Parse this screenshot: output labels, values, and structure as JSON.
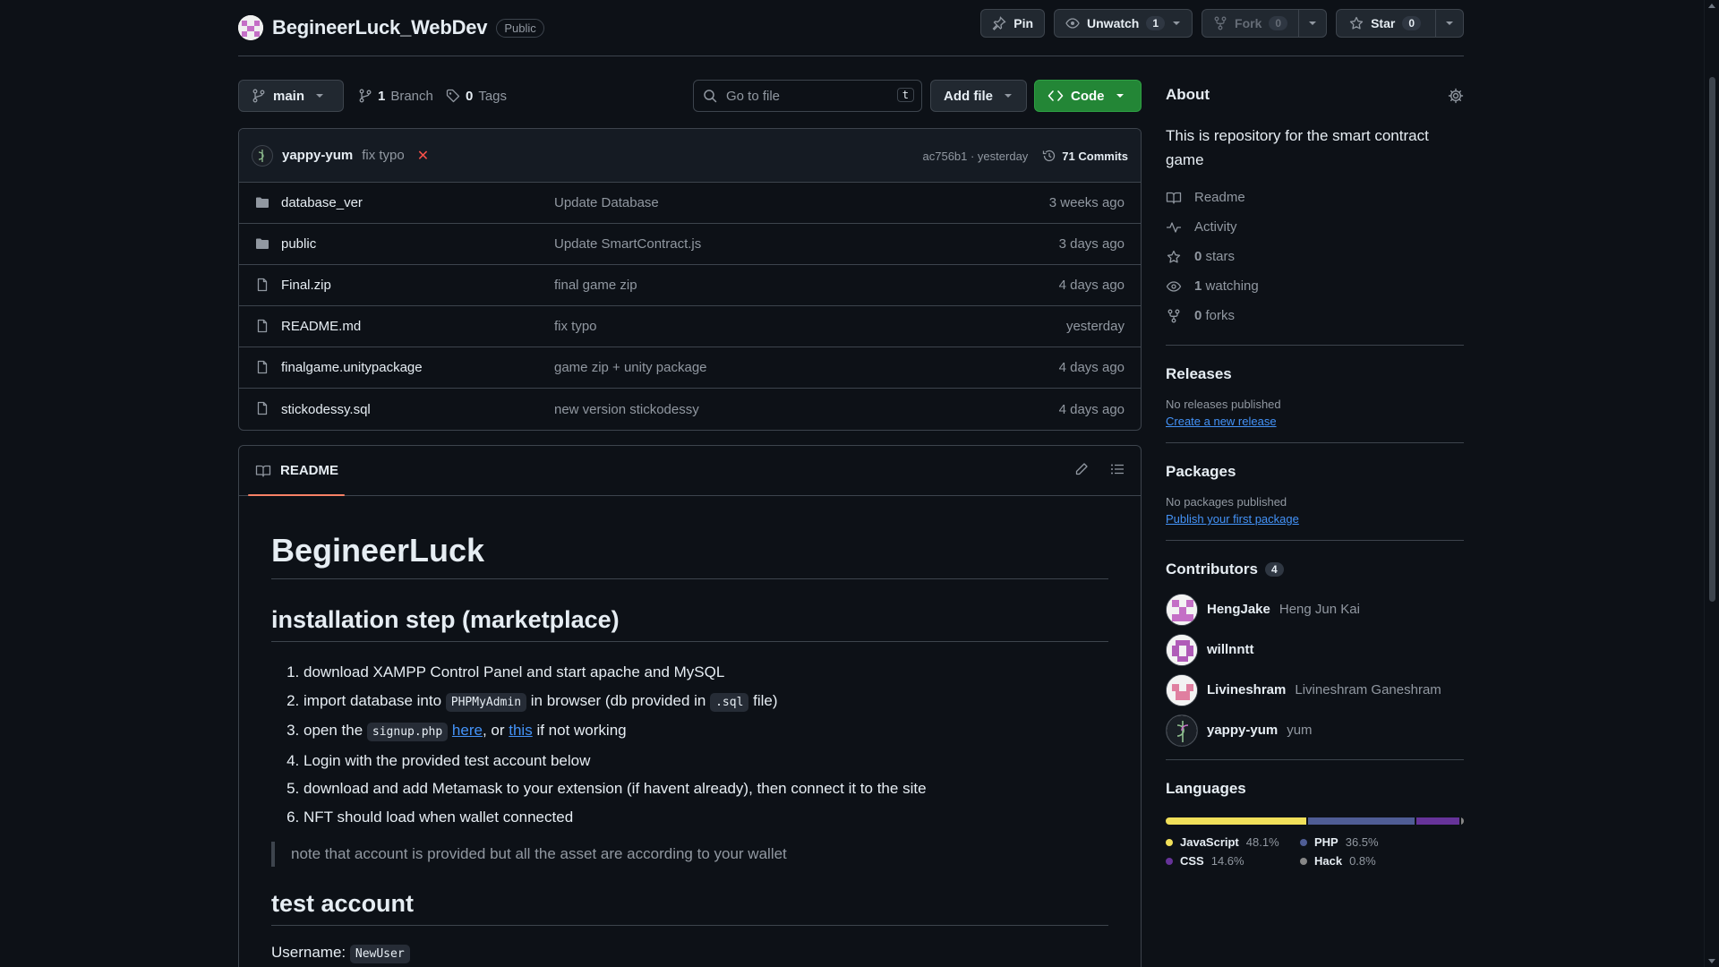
{
  "repo": {
    "name": "BegineerLuck_WebDev",
    "visibility": "Public"
  },
  "actions": {
    "pin": "Pin",
    "unwatch": "Unwatch",
    "watch_count": "1",
    "fork": "Fork",
    "fork_count": "0",
    "star": "Star",
    "star_count": "0"
  },
  "toolbar": {
    "branch": "main",
    "branches_count": "1",
    "branches_label": "Branch",
    "tags_count": "0",
    "tags_label": "Tags",
    "search_placeholder": "Go to file",
    "search_shortcut": "t",
    "add_file": "Add file",
    "code": "Code"
  },
  "latest_commit": {
    "user": "yappy-yum",
    "message": "fix typo",
    "status": "✕",
    "sha_time": "ac756b1 · yesterday",
    "commits": "71 Commits"
  },
  "files": [
    {
      "type": "dir",
      "name": "database_ver",
      "commit": "Update Database",
      "date": "3 weeks ago"
    },
    {
      "type": "dir",
      "name": "public",
      "commit": "Update SmartContract.js",
      "date": "3 days ago"
    },
    {
      "type": "file",
      "name": "Final.zip",
      "commit": "final game zip",
      "date": "4 days ago"
    },
    {
      "type": "file",
      "name": "README.md",
      "commit": "fix typo",
      "date": "yesterday"
    },
    {
      "type": "file",
      "name": "finalgame.unitypackage",
      "commit": "game zip + unity package",
      "date": "4 days ago"
    },
    {
      "type": "file",
      "name": "stickodessy.sql",
      "commit": "new version stickodessy",
      "date": "4 days ago"
    }
  ],
  "readme": {
    "tab": "README",
    "h1": "BegineerLuck",
    "h2_install": "installation step (marketplace)",
    "step1": "download XAMPP Control Panel and start apache and MySQL",
    "step2_a": "import database into ",
    "step2_code1": "PHPMyAdmin",
    "step2_b": " in browser (db provided in ",
    "step2_code2": ".sql",
    "step2_c": " file)",
    "step3_a": "open the ",
    "step3_code": "signup.php",
    "step3_link1": "here",
    "step3_b": ", or ",
    "step3_link2": "this",
    "step3_c": " if not working",
    "step4": "Login with the provided test account below",
    "step5": "download and add Metamask to your extension (if havent already), then connect it to the site",
    "step6": "NFT should load when wallet connected",
    "quote": "note that account is provided but all the asset are according to your wallet",
    "h2_test": "test account",
    "username_label": "Username: ",
    "username_value": "NewUser"
  },
  "about": {
    "title": "About",
    "description": "This is repository for the smart contract game",
    "readme": "Readme",
    "activity": "Activity",
    "stars_count": "0",
    "stars_label": "stars",
    "watching_count": "1",
    "watching_label": "watching",
    "forks_count": "0",
    "forks_label": "forks"
  },
  "releases": {
    "title": "Releases",
    "none": "No releases published",
    "link": "Create a new release"
  },
  "packages": {
    "title": "Packages",
    "none": "No packages published",
    "link": "Publish your first package"
  },
  "contributors": {
    "title": "Contributors",
    "count": "4",
    "list": [
      {
        "login": "HengJake",
        "name": "Heng Jun Kai"
      },
      {
        "login": "willnntt",
        "name": ""
      },
      {
        "login": "Livineshram",
        "name": "Livineshram Ganeshram"
      },
      {
        "login": "yappy-yum",
        "name": "yum"
      }
    ]
  },
  "languages": {
    "title": "Languages",
    "list": [
      {
        "name": "JavaScript",
        "pct": "48.1%",
        "value": 48.1,
        "color": "#f1e05a"
      },
      {
        "name": "PHP",
        "pct": "36.5%",
        "value": 36.5,
        "color": "#4F5D95"
      },
      {
        "name": "CSS",
        "pct": "14.6%",
        "value": 14.6,
        "color": "#663399"
      },
      {
        "name": "Hack",
        "pct": "0.8%",
        "value": 0.8,
        "color": "#878787"
      }
    ]
  }
}
